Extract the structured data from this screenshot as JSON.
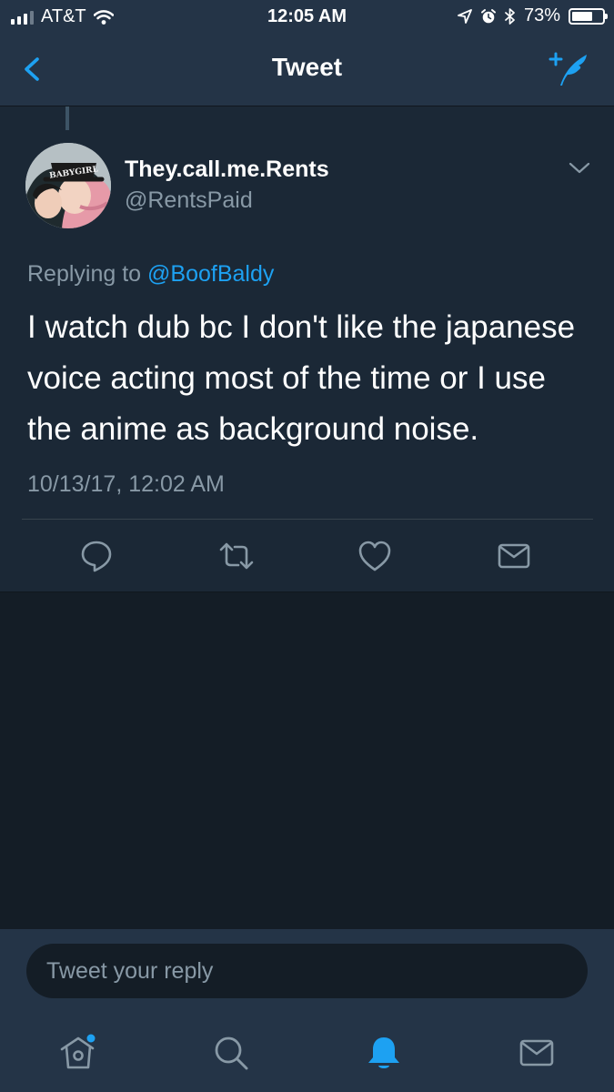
{
  "status": {
    "carrier": "AT&T",
    "time": "12:05 AM",
    "battery_percent": "73%",
    "battery_level": 0.73
  },
  "nav": {
    "title": "Tweet",
    "back_icon": "chevron-left-icon",
    "compose_icon": "compose-tweet-icon"
  },
  "tweet": {
    "display_name": "They.call.me.Rents",
    "handle": "@RentsPaid",
    "replying_prefix": "Replying to",
    "replying_to": "@BoofBaldy",
    "text": "I watch dub bc I don't like the japanese voice acting most of the time or I use the anime as background noise.",
    "timestamp": "10/13/17, 12:02 AM",
    "avatar_label": "BABYGIRL",
    "actions": [
      "reply-icon",
      "retweet-icon",
      "like-icon",
      "direct-message-icon"
    ]
  },
  "reply": {
    "placeholder": "Tweet your reply"
  },
  "tabs": {
    "items": [
      "home-icon",
      "search-icon",
      "notifications-icon",
      "messages-icon"
    ],
    "active": "notifications-icon",
    "home_has_badge": true
  },
  "colors": {
    "background": "#141d26",
    "card": "#1b2836",
    "bars": "#243447",
    "accent": "#1da1f2",
    "secondary_text": "#8899a6"
  }
}
